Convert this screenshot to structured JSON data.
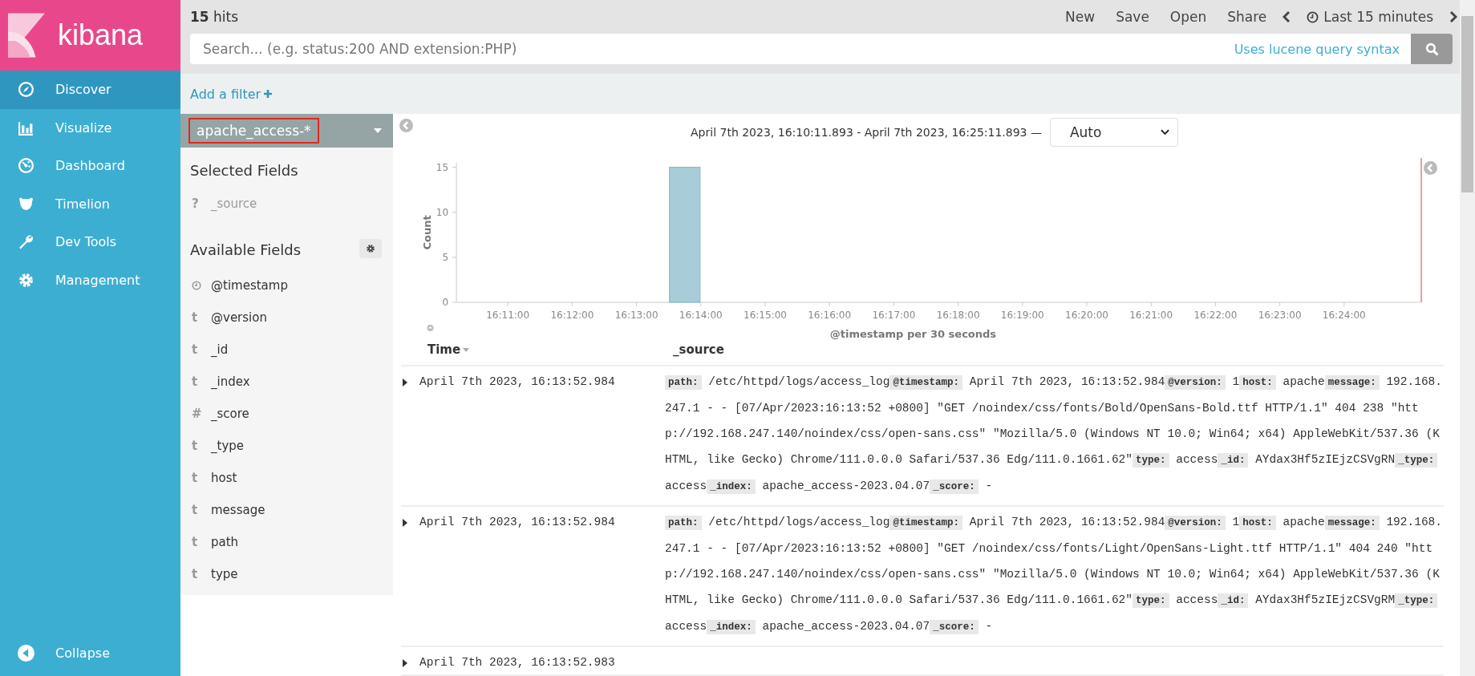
{
  "brand": {
    "name": "kibana"
  },
  "nav": {
    "items": [
      {
        "label": "Discover",
        "selected": true
      },
      {
        "label": "Visualize",
        "selected": false
      },
      {
        "label": "Dashboard",
        "selected": false
      },
      {
        "label": "Timelion",
        "selected": false
      },
      {
        "label": "Dev Tools",
        "selected": false
      },
      {
        "label": "Management",
        "selected": false
      }
    ],
    "collapse": "Collapse"
  },
  "hits": {
    "count": "15",
    "label": "hits"
  },
  "actions": [
    "New",
    "Save",
    "Open",
    "Share"
  ],
  "time_picker": {
    "label": "Last 15 minutes"
  },
  "search": {
    "placeholder": "Search... (e.g. status:200 AND extension:PHP)",
    "syntax_link": "Uses lucene query syntax"
  },
  "add_filter": "Add a filter",
  "index_pattern": {
    "name": "apache_access-*",
    "highlighted": true
  },
  "selected_fields": {
    "title": "Selected Fields",
    "items": [
      {
        "kind": "unknown",
        "symbol": "?",
        "name": "_source"
      }
    ]
  },
  "available_fields": {
    "title": "Available Fields",
    "items": [
      {
        "kind": "date",
        "name": "@timestamp"
      },
      {
        "kind": "string",
        "symbol": "t",
        "name": "@version"
      },
      {
        "kind": "string",
        "symbol": "t",
        "name": "_id"
      },
      {
        "kind": "string",
        "symbol": "t",
        "name": "_index"
      },
      {
        "kind": "number",
        "symbol": "#",
        "name": "_score"
      },
      {
        "kind": "string",
        "symbol": "t",
        "name": "_type"
      },
      {
        "kind": "string",
        "symbol": "t",
        "name": "host"
      },
      {
        "kind": "string",
        "symbol": "t",
        "name": "message"
      },
      {
        "kind": "string",
        "symbol": "t",
        "name": "path"
      },
      {
        "kind": "string",
        "symbol": "t",
        "name": "type"
      }
    ]
  },
  "histogram": {
    "range": "April 7th 2023, 16:10:11.893 - April 7th 2023, 16:25:11.893 —",
    "interval": "Auto",
    "chart_data": {
      "type": "bar",
      "xlabel": "@timestamp per 30 seconds",
      "ylabel": "Count",
      "categories": [
        null,
        null,
        "16:11:00",
        null,
        "16:12:00",
        null,
        "16:13:00",
        null,
        "16:14:00",
        null,
        "16:15:00",
        null,
        "16:16:00",
        null,
        "16:17:00",
        null,
        "16:18:00",
        null,
        "16:19:00",
        null,
        "16:20:00",
        null,
        "16:21:00",
        null,
        "16:22:00",
        null,
        "16:23:00",
        null,
        "16:24:00",
        null
      ],
      "values": [
        0,
        0,
        0,
        0,
        0,
        0,
        0,
        15,
        0,
        0,
        0,
        0,
        0,
        0,
        0,
        0,
        0,
        0,
        0,
        0,
        0,
        0,
        0,
        0,
        0,
        0,
        0,
        0,
        0,
        0
      ],
      "ylim": [
        0,
        15.5
      ],
      "yticks": [
        0,
        5,
        10,
        15
      ]
    }
  },
  "table": {
    "columns": [
      "Time",
      "_source"
    ],
    "rows": [
      {
        "time": "April 7th 2023, 16:13:52.984",
        "fields": [
          {
            "key": "path:",
            "value": "/etc/httpd/logs/access_log"
          },
          {
            "key": "@timestamp:",
            "value": "April 7th 2023, 16:13:52.984"
          },
          {
            "key": "@version:",
            "value": "1"
          },
          {
            "key": "host:",
            "value": "apache"
          },
          {
            "key": "message:",
            "value": "192.168.247.1 - - [07/Apr/2023:16:13:52 +0800] \"GET /noindex/css/fonts/Bold/OpenSans-Bold.ttf HTTP/1.1\" 404 238 \"http://192.168.247.140/noindex/css/open-sans.css\" \"Mozilla/5.0 (Windows NT 10.0; Win64; x64) AppleWebKit/537.36 (KHTML, like Gecko) Chrome/111.0.0.0 Safari/537.36 Edg/111.0.1661.62\""
          },
          {
            "key": "type:",
            "value": "access"
          },
          {
            "key": "_id:",
            "value": "AYdax3Hf5zIEjzCSVgRN"
          },
          {
            "key": "_type:",
            "value": "access"
          },
          {
            "key": "_index:",
            "value": "apache_access-2023.04.07"
          },
          {
            "key": "_score:",
            "value": "-"
          }
        ]
      },
      {
        "time": "April 7th 2023, 16:13:52.984",
        "fields": [
          {
            "key": "path:",
            "value": "/etc/httpd/logs/access_log"
          },
          {
            "key": "@timestamp:",
            "value": "April 7th 2023, 16:13:52.984"
          },
          {
            "key": "@version:",
            "value": "1"
          },
          {
            "key": "host:",
            "value": "apache"
          },
          {
            "key": "message:",
            "value": "192.168.247.1 - - [07/Apr/2023:16:13:52 +0800] \"GET /noindex/css/fonts/Light/OpenSans-Light.ttf HTTP/1.1\" 404 240 \"http://192.168.247.140/noindex/css/open-sans.css\" \"Mozilla/5.0 (Windows NT 10.0; Win64; x64) AppleWebKit/537.36 (KHTML, like Gecko) Chrome/111.0.0.0 Safari/537.36 Edg/111.0.1661.62\""
          },
          {
            "key": "type:",
            "value": "access"
          },
          {
            "key": "_id:",
            "value": "AYdax3Hf5zIEjzCSVgRM"
          },
          {
            "key": "_type:",
            "value": "access"
          },
          {
            "key": "_index:",
            "value": "apache_access-2023.04.07"
          },
          {
            "key": "_score:",
            "value": "-"
          }
        ]
      },
      {
        "time": "April 7th 2023, 16:13:52.983",
        "fields": []
      }
    ]
  }
}
